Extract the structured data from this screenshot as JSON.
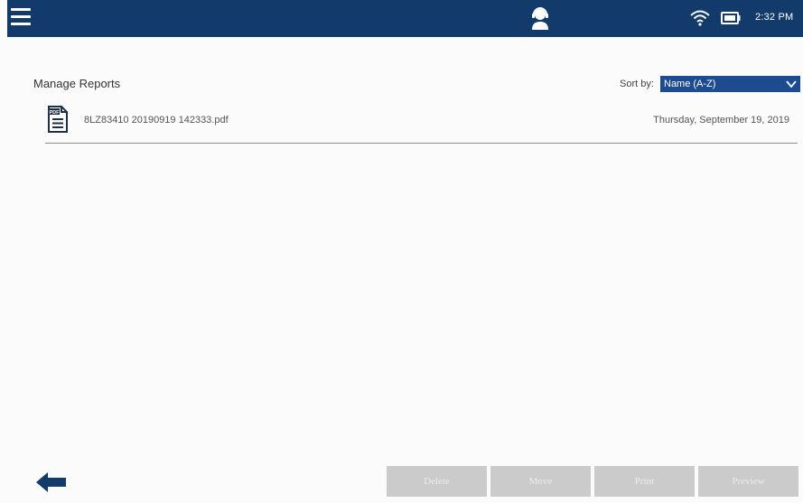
{
  "header": {
    "time": "2:32 PM",
    "icons": [
      "menu-icon",
      "support-agent-icon",
      "wifi-icon",
      "battery-icon"
    ]
  },
  "main": {
    "title": "Manage Reports",
    "sort_label": "Sort by:",
    "sort_value": "Name (A-Z)",
    "reports": [
      {
        "icon": "pdf-file-icon",
        "name": "8LZ83410 20190919 142333.pdf",
        "date": "Thursday, September 19, 2019"
      }
    ]
  },
  "footer": {
    "back_icon": "back-arrow-icon",
    "buttons": {
      "delete": "Delete",
      "move": "Move",
      "print": "Print",
      "preview": "Preview"
    }
  },
  "colors": {
    "header_bg": "#123a6b",
    "select_bg": "#1d4b8f",
    "disabled_button_bg": "#cbcbcb",
    "back_arrow": "#123a6b"
  }
}
